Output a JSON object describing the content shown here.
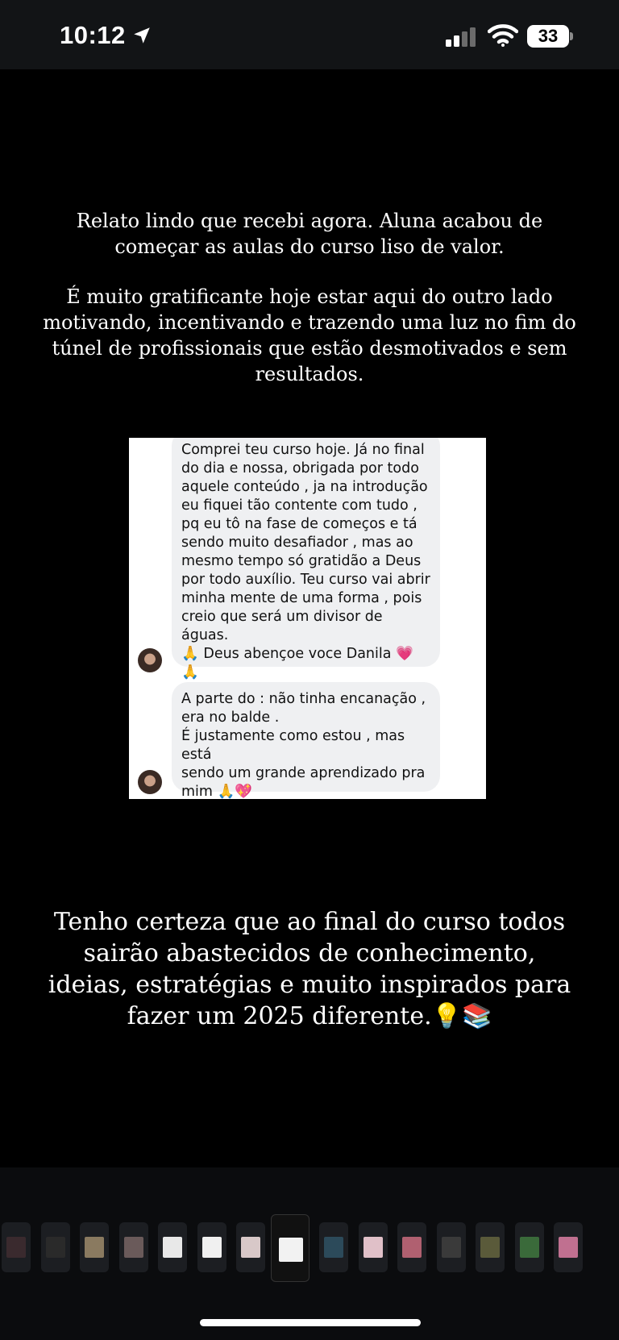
{
  "status_bar": {
    "time": "10:12",
    "battery": "33",
    "icons": [
      "location-arrow-icon",
      "cellular-signal-icon",
      "wifi-icon",
      "battery-icon"
    ]
  },
  "story": {
    "paragraph_1": "Relato lindo que recebi agora. Aluna acabou de começar as aulas do curso liso de valor.",
    "paragraph_2": "É muito gratificante hoje estar aqui do outro lado motivando, incentivando e trazendo uma luz no fim do túnel de profissionais que estão desmotivados e sem resultados.",
    "paragraph_3": "Tenho certeza que ao final do curso todos sairão abastecidos de conhecimento, ideias, estratégias e muito inspirados para fazer um 2025 diferente.💡📚",
    "chat_screenshot": {
      "message_1": "Comprei teu curso hoje. Já no final\ndo dia e nossa, obrigada por todo\naquele conteúdo , ja na introdução\neu fiquei tão contente com tudo ,\npq eu tô na fase de começos e tá\nsendo muito desafiador , mas ao\nmesmo tempo só gratidão a Deus\npor todo auxílio.  Teu curso vai abrir\nminha mente de uma forma , pois\ncreio que será um divisor de águas.\n🙏 Deus abençoe voce Danila 💗\n🙏",
      "message_2": "A parte do : não tinha encanação ,\nera no balde .\nÉ justamente como estou , mas está\nsendo um grande aprendizado pra\nmim 🙏💖"
    }
  },
  "thumbnails": {
    "count": 15,
    "active_index": 7,
    "colors": [
      "#3a2a2e",
      "#2a2a2a",
      "#8a7a60",
      "#6a5a5a",
      "#e8e8e8",
      "#f0f0f0",
      "#d8c8c8",
      "#f2f2f2",
      "#2c4a5a",
      "#e0c0c8",
      "#b06070",
      "#3a3a3a",
      "#5a5a3a",
      "#3a6a3a",
      "#c07090"
    ]
  }
}
